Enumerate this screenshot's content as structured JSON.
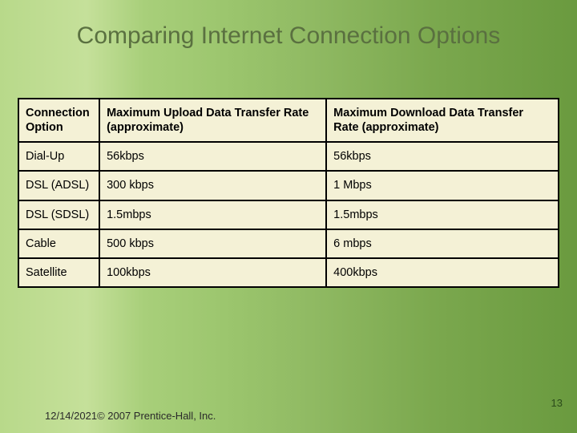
{
  "title": "Comparing Internet Connection Options",
  "headers": {
    "option": "Connection Option",
    "upload": "Maximum  Upload Data Transfer Rate (approximate)",
    "download": "Maximum  Download Data Transfer Rate (approximate)"
  },
  "rows": [
    {
      "option": "Dial-Up",
      "upload": "56kbps",
      "download": "56kbps"
    },
    {
      "option": "DSL (ADSL)",
      "upload": "300 kbps",
      "download": "1 Mbps"
    },
    {
      "option": "DSL (SDSL)",
      "upload": "1.5mbps",
      "download": "1.5mbps"
    },
    {
      "option": "Cable",
      "upload": "500 kbps",
      "download": "6 mbps"
    },
    {
      "option": "Satellite",
      "upload": "100kbps",
      "download": "400kbps"
    }
  ],
  "footer": "12/14/2021© 2007 Prentice-Hall, Inc.",
  "pagenum": "13",
  "chart_data": {
    "type": "table",
    "title": "Comparing Internet Connection Options",
    "columns": [
      "Connection Option",
      "Maximum Upload Data Transfer Rate (approximate)",
      "Maximum Download Data Transfer Rate (approximate)"
    ],
    "rows": [
      [
        "Dial-Up",
        "56kbps",
        "56kbps"
      ],
      [
        "DSL (ADSL)",
        "300 kbps",
        "1 Mbps"
      ],
      [
        "DSL (SDSL)",
        "1.5mbps",
        "1.5mbps"
      ],
      [
        "Cable",
        "500 kbps",
        "6 mbps"
      ],
      [
        "Satellite",
        "100kbps",
        "400kbps"
      ]
    ]
  }
}
